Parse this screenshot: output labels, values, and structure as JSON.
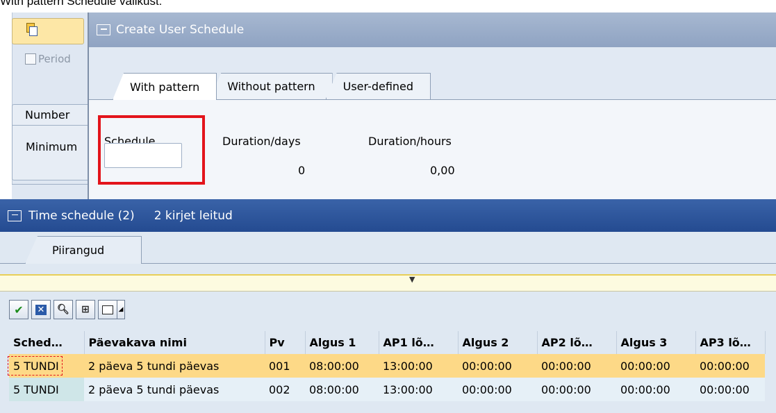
{
  "caption": "With pattern Schedule valikust:",
  "background_window": {
    "period_label": "Period",
    "number_label": "Number",
    "minimum_label": "Minimum"
  },
  "dialog": {
    "title": "Create User Schedule",
    "tabs": [
      {
        "label": "With pattern",
        "active": true
      },
      {
        "label": "Without pattern",
        "active": false
      },
      {
        "label": "User-defined",
        "active": false
      }
    ],
    "schedule_label": "Schedule",
    "schedule_value": "",
    "duration_days_label": "Duration/days",
    "duration_days_value": "0",
    "duration_hours_label": "Duration/hours",
    "duration_hours_value": "0,00"
  },
  "time_schedule": {
    "title": "Time schedule (2)",
    "subtitle": "2 kirjet leitud",
    "tab_label": "Piirangud",
    "toolbar": [
      "check-icon",
      "cancel-icon",
      "find-icon",
      "find-next-icon",
      "print-icon"
    ],
    "columns": [
      "Sched…",
      "Päevakava nimi",
      "Pv",
      "Algus 1",
      "AP1 lõ…",
      "Algus 2",
      "AP2 lõ…",
      "Algus 3",
      "AP3 lõ…"
    ],
    "rows": [
      [
        "5 TUNDI",
        "2 päeva 5 tundi päevas",
        "001",
        "08:00:00",
        "13:00:00",
        "00:00:00",
        "00:00:00",
        "00:00:00",
        "00:00:00"
      ],
      [
        "5 TUNDI",
        "2 päeva 5 tundi päevas",
        "002",
        "08:00:00",
        "13:00:00",
        "00:00:00",
        "00:00:00",
        "00:00:00",
        "00:00:00"
      ]
    ]
  },
  "colors": {
    "highlight": "#e3141b",
    "selected_row": "#fdd987",
    "title_bar": "#244b91"
  }
}
